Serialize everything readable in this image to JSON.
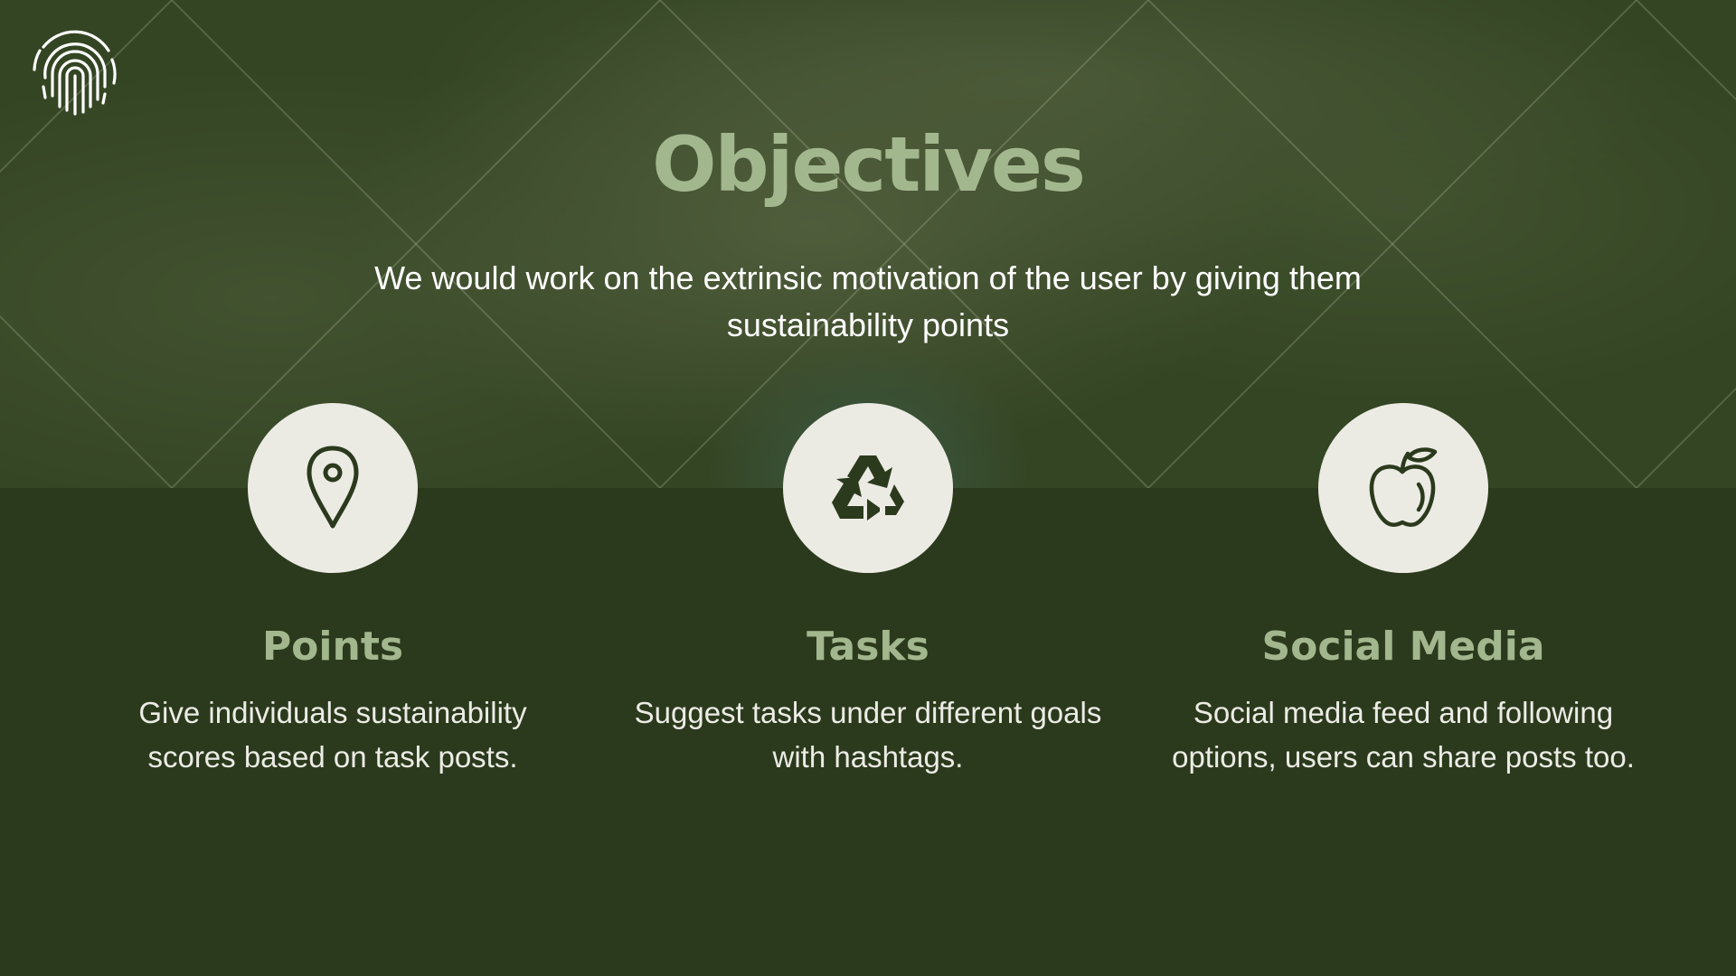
{
  "slide": {
    "title": "Objectives",
    "subtitle": "We would work on the extrinsic motivation of the user by giving them sustainability points"
  },
  "cards": [
    {
      "title": "Points",
      "text": "Give individuals sustainability scores based on task posts.",
      "icon": "location-pin-icon"
    },
    {
      "title": "Tasks",
      "text": "Suggest tasks under different goals with hashtags.",
      "icon": "recycle-icon"
    },
    {
      "title": "Social Media",
      "text": "Social media feed and following options, users can share posts too.",
      "icon": "apple-icon"
    }
  ],
  "colors": {
    "background": "#2b3a1c",
    "accent": "#a3b78f",
    "icon_circle": "#ebebe4",
    "icon_stroke": "#2b3a1c",
    "text": "#ecece6"
  }
}
